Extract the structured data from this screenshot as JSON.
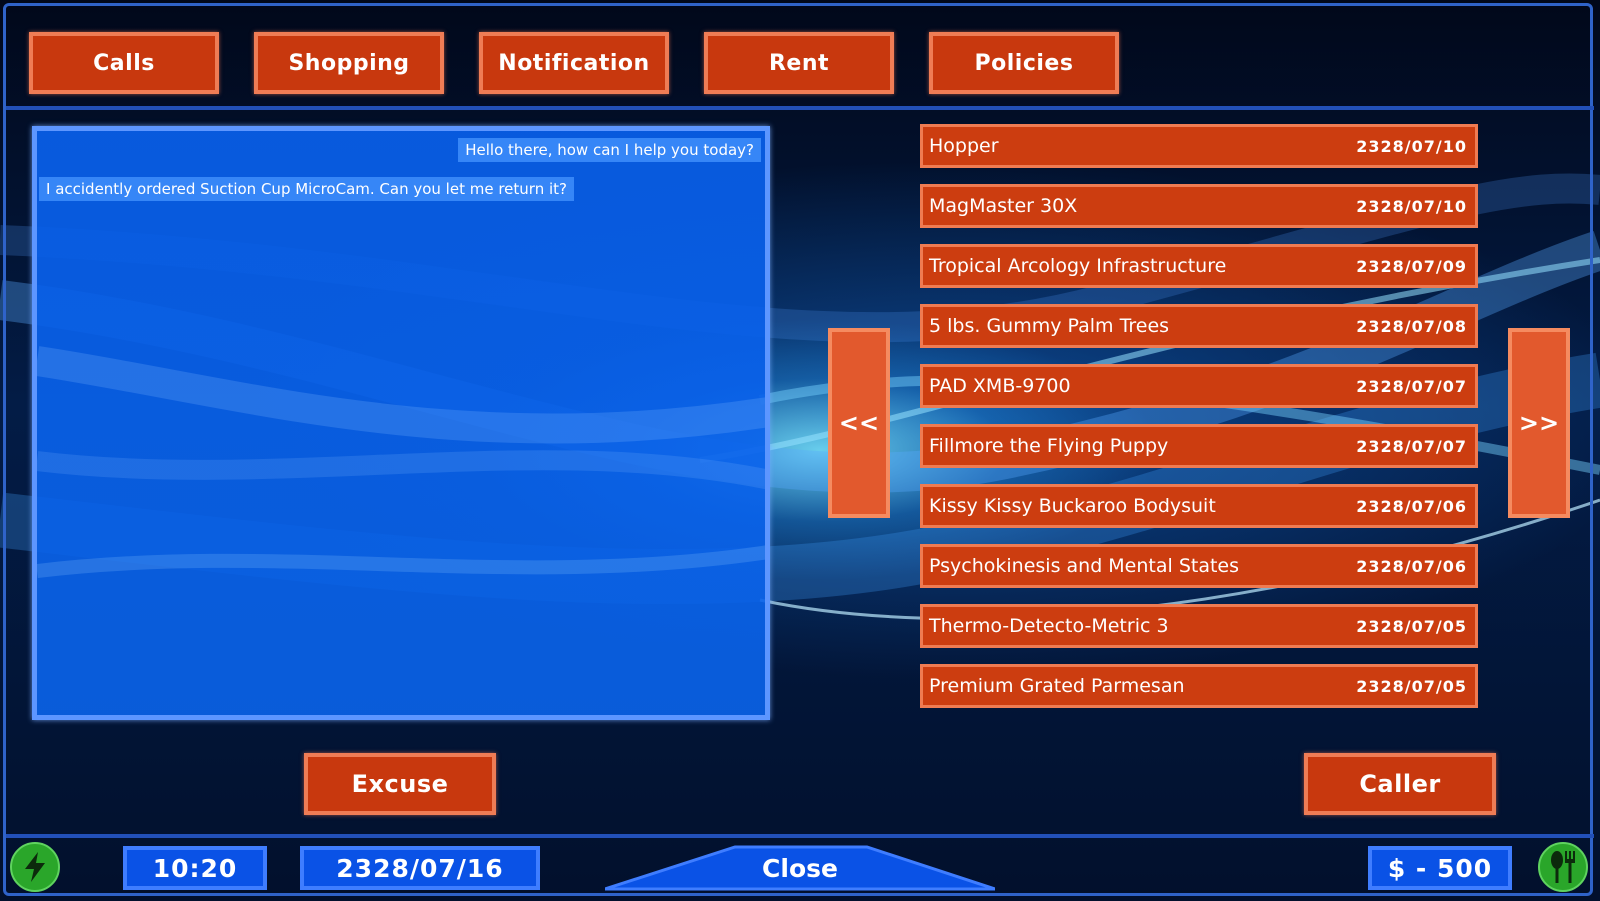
{
  "nav": {
    "tabs": [
      {
        "label": "Calls"
      },
      {
        "label": "Shopping"
      },
      {
        "label": "Notification"
      },
      {
        "label": "Rent"
      },
      {
        "label": "Policies"
      }
    ]
  },
  "chat": {
    "messages": [
      {
        "text": "Hello there, how can I help you today?",
        "side": "right"
      },
      {
        "text": "I accidently ordered Suction Cup MicroCam. Can you let me return it?",
        "side": "left"
      }
    ]
  },
  "orders": {
    "prev_label": "<<",
    "next_label": ">>",
    "items": [
      {
        "name": "Hopper",
        "date": "2328/07/10"
      },
      {
        "name": "MagMaster 30X",
        "date": "2328/07/10"
      },
      {
        "name": "Tropical Arcology Infrastructure",
        "date": "2328/07/09"
      },
      {
        "name": "5 lbs. Gummy Palm Trees",
        "date": "2328/07/08"
      },
      {
        "name": "PAD XMB-9700",
        "date": "2328/07/07"
      },
      {
        "name": "Fillmore the Flying Puppy",
        "date": "2328/07/07"
      },
      {
        "name": "Kissy Kissy Buckaroo Bodysuit",
        "date": "2328/07/06"
      },
      {
        "name": "Psychokinesis and Mental States",
        "date": "2328/07/06"
      },
      {
        "name": "Thermo-Detecto-Metric 3",
        "date": "2328/07/05"
      },
      {
        "name": "Premium Grated Parmesan",
        "date": "2328/07/05"
      }
    ]
  },
  "actions": {
    "excuse_label": "Excuse",
    "caller_label": "Caller"
  },
  "status": {
    "time": "10:20",
    "date": "2328/07/16",
    "close_label": "Close",
    "money": "$ - 500",
    "energy_icon": "lightning-icon",
    "food_icon": "utensils-icon"
  },
  "colors": {
    "button_fill": "#c8380e",
    "button_border": "#ef7c55",
    "panel_blue": "#0a5fe8",
    "frame_blue": "#2f63c9",
    "status_green": "#2aa62a"
  }
}
